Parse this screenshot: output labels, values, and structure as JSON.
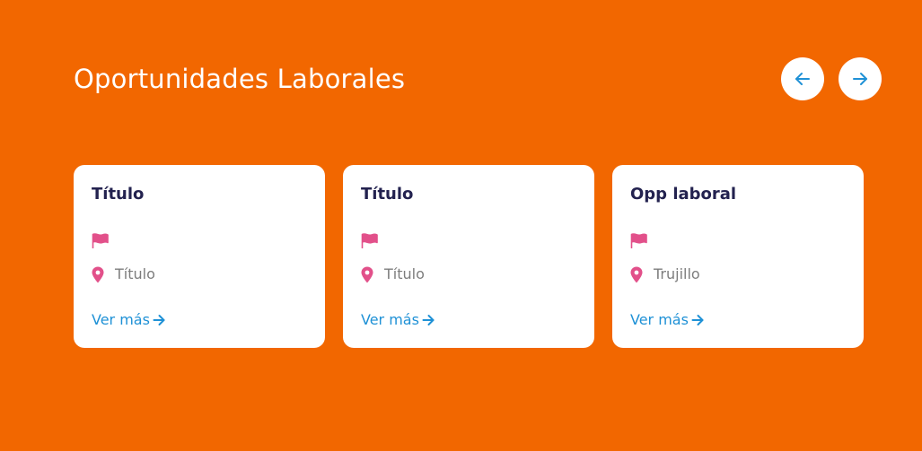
{
  "section": {
    "title": "Oportunidades Laborales"
  },
  "nav": {
    "prev_icon": "arrow-left-icon",
    "next_icon": "arrow-right-icon"
  },
  "colors": {
    "background": "#f26700",
    "card_title": "#23224f",
    "accent_pink": "#e2508a",
    "link_blue": "#1f91d6"
  },
  "cards": [
    {
      "title": "Título",
      "category": "",
      "location": "Título",
      "link_label": "Ver más"
    },
    {
      "title": "Título",
      "category": "",
      "location": "Título",
      "link_label": "Ver más"
    },
    {
      "title": "Opp laboral",
      "category": "",
      "location": "Trujillo",
      "link_label": "Ver más"
    }
  ]
}
